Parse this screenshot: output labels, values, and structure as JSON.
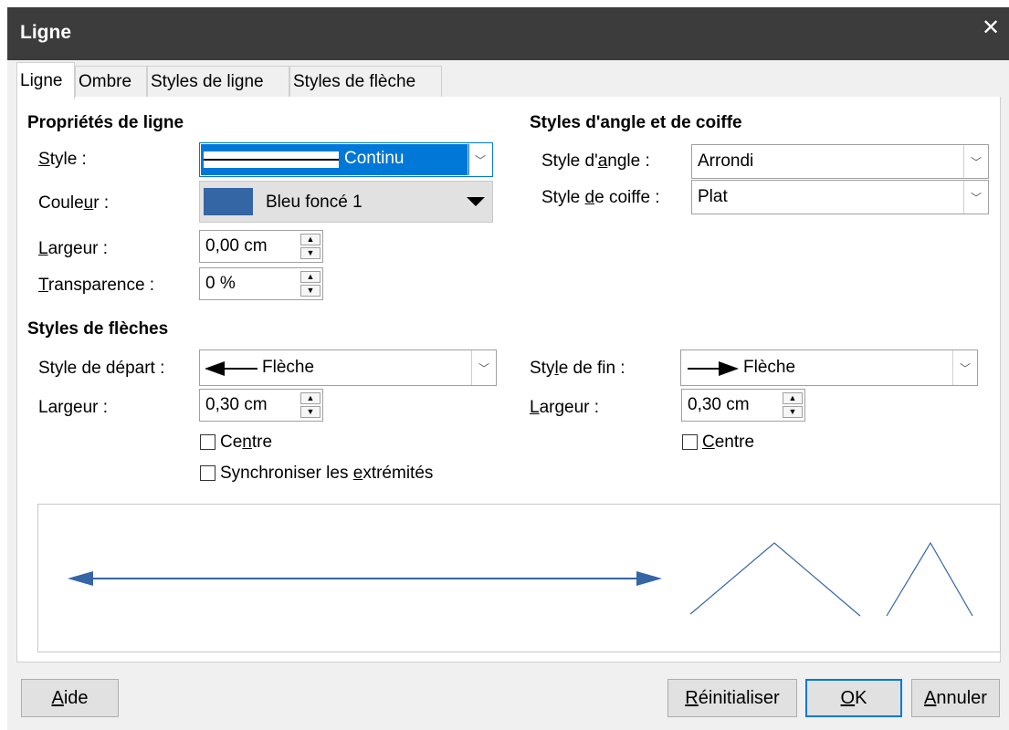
{
  "window": {
    "title": "Ligne",
    "close_glyph": "✕"
  },
  "tabs": [
    {
      "label": "Ligne",
      "active": true
    },
    {
      "label": "Ombre",
      "active": false
    },
    {
      "label": "Styles de ligne",
      "active": false
    },
    {
      "label": "Styles de flèche",
      "active": false
    }
  ],
  "line_props": {
    "heading": "Propriétés de ligne",
    "style_label": "Style :",
    "style_value": "Continu",
    "color_label": "Couleur :",
    "color_value": "Bleu foncé 1",
    "color_swatch": "#3465a4",
    "width_label": "Largeur :",
    "width_value": "0,00 cm",
    "transparency_label": "Transparence :",
    "transparency_value": "0 %"
  },
  "corner_cap": {
    "heading": "Styles d'angle et de coiffe",
    "corner_label": "Style d'angle :",
    "corner_value": "Arrondi",
    "cap_label": "Style de coiffe :",
    "cap_value": "Plat"
  },
  "arrows": {
    "heading": "Styles de flèches",
    "start_label": "Style de départ :",
    "start_value": "Flèche",
    "start_width_label": "Largeur :",
    "start_width_value": "0,30 cm",
    "start_center_label": "Centre",
    "sync_label": "Synchroniser les extrémités",
    "end_label": "Style de fin :",
    "end_value": "Flèche",
    "end_width_label": "Largeur :",
    "end_width_value": "0,30 cm",
    "end_center_label": "Centre"
  },
  "buttons": {
    "help": "Aide",
    "reset": "Réinitialiser",
    "ok": "OK",
    "cancel": "Annuler"
  },
  "colors": {
    "selection": "#0078d7",
    "line_preview": "#3465a4"
  }
}
